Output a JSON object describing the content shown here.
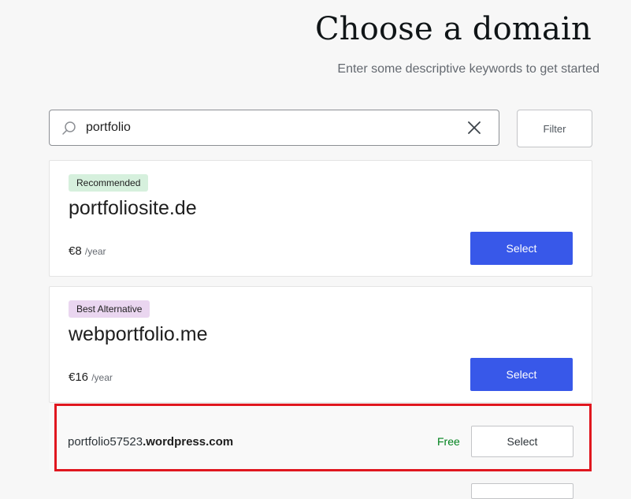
{
  "header": {
    "title": "Choose a domain",
    "subtitle": "Enter some descriptive keywords to get started"
  },
  "search": {
    "value": "portfolio",
    "filter_label": "Filter"
  },
  "results": [
    {
      "badge": "Recommended",
      "badge_color": "#d6f0dd",
      "domain": "portfoliosite.de",
      "price": "€8",
      "per": "/year",
      "select_label": "Select"
    },
    {
      "badge": "Best Alternative",
      "badge_color": "#ead6f0",
      "domain": "webportfolio.me",
      "price": "€16",
      "per": "/year",
      "select_label": "Select"
    }
  ],
  "free_option": {
    "domain_prefix": "portfolio57523",
    "domain_suffix": ".wordpress.com",
    "price_label": "Free",
    "select_label": "Select"
  },
  "colors": {
    "accent": "#3858e9",
    "free": "#00821d",
    "highlight": "#e0171f"
  }
}
